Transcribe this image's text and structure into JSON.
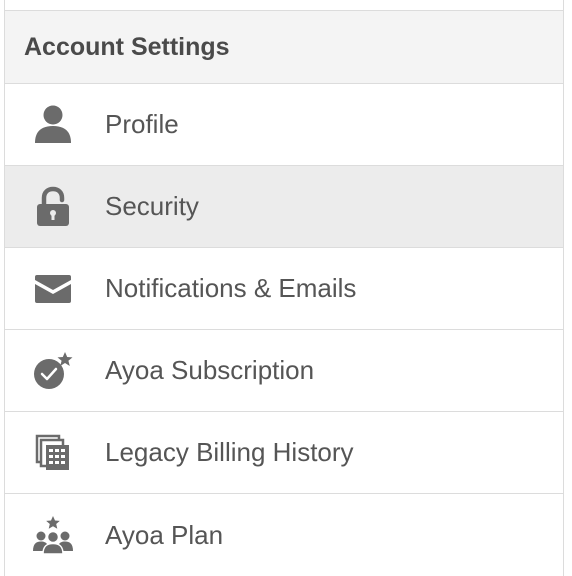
{
  "header": {
    "title": "Account Settings"
  },
  "menu": {
    "items": [
      {
        "label": "Profile",
        "icon": "user-icon",
        "active": false
      },
      {
        "label": "Security",
        "icon": "lock-icon",
        "active": true
      },
      {
        "label": "Notifications & Emails",
        "icon": "envelope-icon",
        "active": false
      },
      {
        "label": "Ayoa Subscription",
        "icon": "subscription-badge-icon",
        "active": false
      },
      {
        "label": "Legacy Billing History",
        "icon": "billing-documents-icon",
        "active": false
      },
      {
        "label": "Ayoa Plan",
        "icon": "team-star-icon",
        "active": false
      }
    ]
  },
  "colors": {
    "icon": "#6b6b6b",
    "text": "#555555",
    "header_bg": "#f4f4f4",
    "active_bg": "#ececec",
    "border": "#dcdcdc"
  }
}
